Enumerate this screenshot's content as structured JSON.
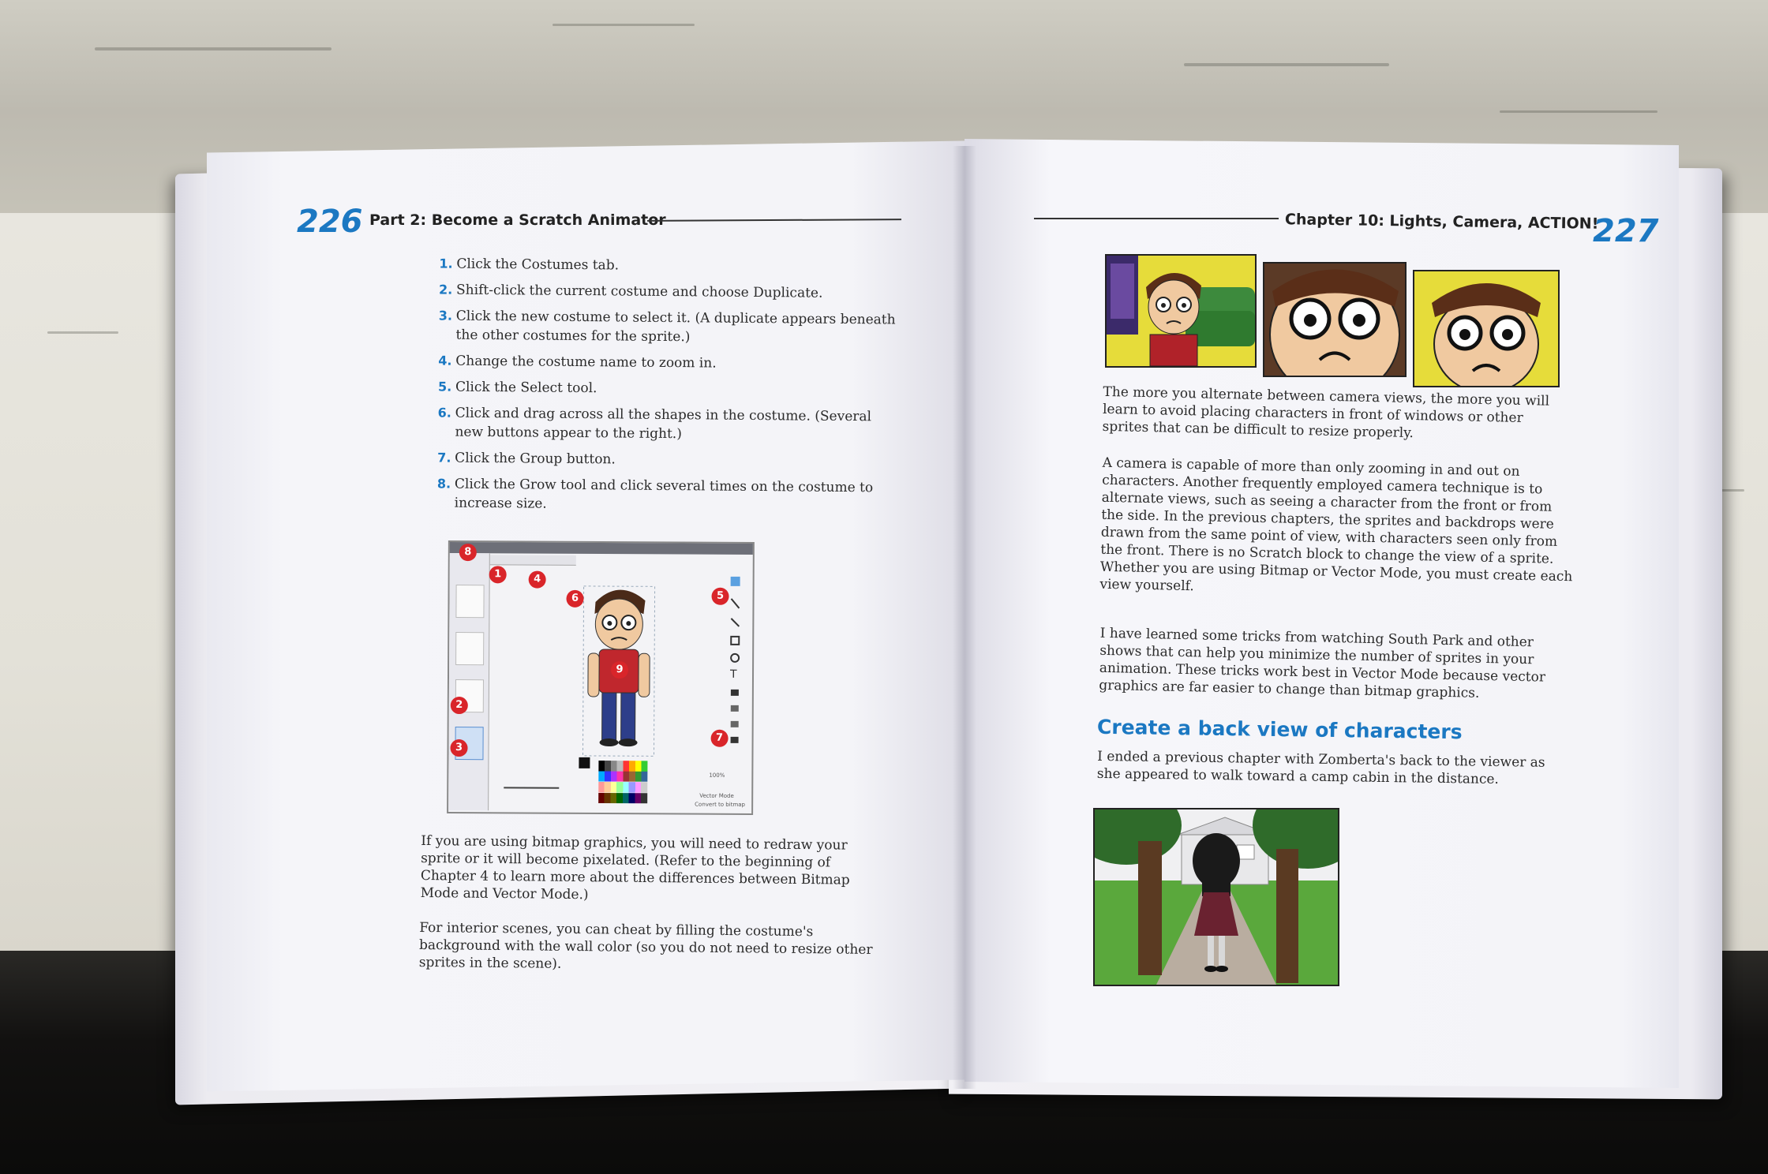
{
  "left_page": {
    "folio": "226",
    "running_head": "Part 2: Become a Scratch Animator",
    "steps": [
      {
        "num": "1.",
        "text": "Click the Costumes tab."
      },
      {
        "num": "2.",
        "text": "Shift-click the current costume and choose Duplicate."
      },
      {
        "num": "3.",
        "text": "Click the new costume to select it. (A duplicate appears beneath the other costumes for the sprite.)"
      },
      {
        "num": "4.",
        "text": "Change the costume name to zoom in."
      },
      {
        "num": "5.",
        "text": "Click the Select tool."
      },
      {
        "num": "6.",
        "text": "Click and drag across all the shapes in the costume. (Several new buttons appear to the right.)"
      },
      {
        "num": "7.",
        "text": "Click the Group button."
      },
      {
        "num": "8.",
        "text": "Click the Grow tool and click several times on the costume to increase size."
      }
    ],
    "screenshot": {
      "badges": [
        "1",
        "2",
        "3",
        "4",
        "5",
        "6",
        "7",
        "8",
        "9"
      ],
      "labels": {
        "mode": "Vector Mode",
        "convert": "Convert to bitmap",
        "zoom": "100%"
      }
    },
    "para1": "If you are using bitmap graphics, you will need to redraw your sprite or it will become pixelated. (Refer to the beginning of Chapter 4 to learn more about the differences between Bitmap Mode and Vector Mode.)",
    "para2": "For interior scenes, you can cheat by filling the costume's background with the wall color (so you do not need to resize other sprites in the scene)."
  },
  "right_page": {
    "folio": "227",
    "running_head": "Chapter 10: Lights, Camera, ACTION!",
    "para1": "The more you alternate between camera views, the more you will learn to avoid placing characters in front of windows or other sprites that can be difficult to resize properly.",
    "para2": "A camera is capable of more than only zooming in and out on characters. Another frequently employed camera technique is to alternate views, such as seeing a character from the front or from the side. In the previous chapters, the sprites and backdrops were drawn from the same point of view, with characters seen only from the front. There is no Scratch block to change the view of a sprite. Whether you are using Bitmap or Vector Mode, you must create each view yourself.",
    "para3": "I have learned some tricks from watching South Park and other shows that can help you minimize the number of sprites in your animation. These tricks work best in Vector Mode because vector graphics are far easier to change than bitmap graphics.",
    "heading": "Create a back view of characters",
    "para4": "I ended a previous chapter with Zomberta's back to the viewer as she appeared to walk toward a camp cabin in the distance."
  },
  "colors": {
    "accent_blue": "#1b78c2",
    "badge_red": "#d9252a",
    "panel_yellow": "#e6dc3a",
    "grass_green": "#5aa83c"
  }
}
